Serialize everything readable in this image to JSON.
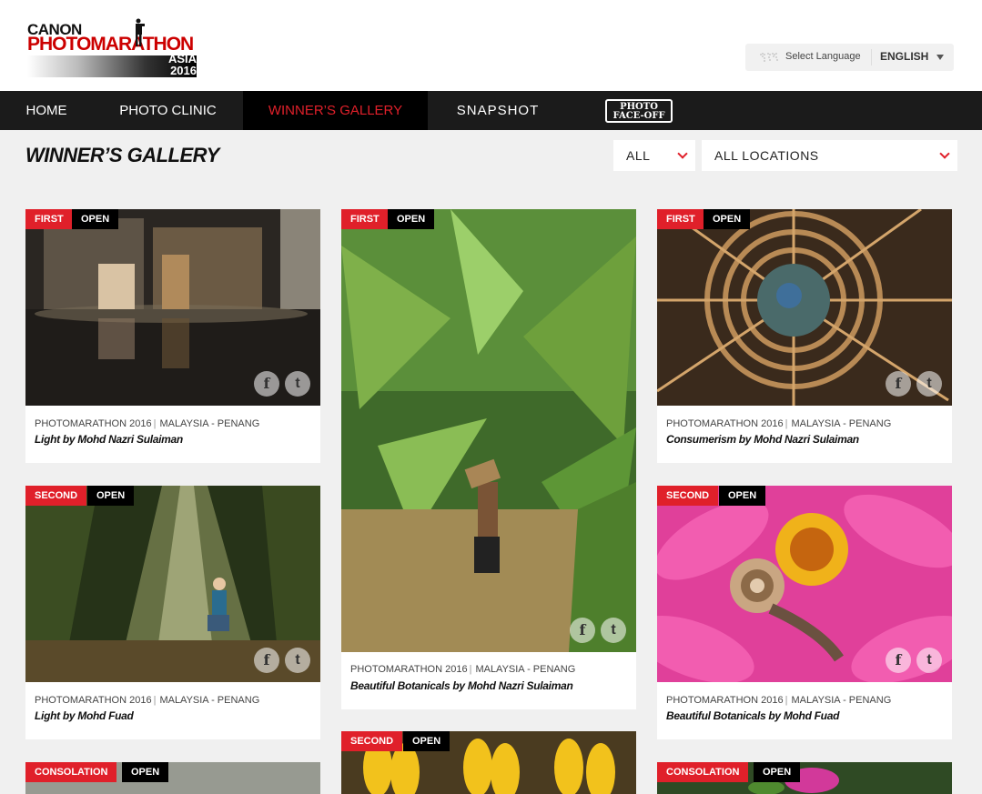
{
  "header": {
    "logo_line1": "CANON",
    "logo_line2": "PHOTOMARATHON",
    "logo_line3a": "ASIA",
    "logo_line3b": "2016",
    "select_language_label": "Select Language",
    "language": "ENGLISH"
  },
  "nav": {
    "home": "HOME",
    "photo_clinic": "PHOTO CLINIC",
    "winners_gallery": "WINNER’S GALLERY",
    "snapshot": "SNAPSHOT",
    "face_off_line1": "PHOTO",
    "face_off_line2": "FACE-OFF"
  },
  "page": {
    "title": "WINNER’S GALLERY",
    "filter_category": "ALL",
    "filter_location": "ALL LOCATIONS"
  },
  "accent_color": "#e0202a",
  "cards": [
    {
      "rank": "FIRST",
      "category": "OPEN",
      "event": "PHOTOMARATHON 2016",
      "location": "MALAYSIA - PENANG",
      "caption": "Light by Mohd Nazri Sulaiman"
    },
    {
      "rank": "FIRST",
      "category": "OPEN",
      "event": "PHOTOMARATHON 2016",
      "location": "MALAYSIA - PENANG",
      "caption": "Beautiful Botanicals by Mohd Nazri Sulaiman"
    },
    {
      "rank": "FIRST",
      "category": "OPEN",
      "event": "PHOTOMARATHON 2016",
      "location": "MALAYSIA - PENANG",
      "caption": "Consumerism by Mohd Nazri Sulaiman"
    },
    {
      "rank": "SECOND",
      "category": "OPEN",
      "event": "PHOTOMARATHON 2016",
      "location": "MALAYSIA - PENANG",
      "caption": "Light by Mohd Fuad"
    },
    {
      "rank": "SECOND",
      "category": "OPEN",
      "event": "PHOTOMARATHON 2016",
      "location": "MALAYSIA - PENANG",
      "caption": "Beautiful Botanicals by Mohd Fuad"
    },
    {
      "rank": "SECOND",
      "category": "OPEN"
    },
    {
      "rank": "CONSOLATION",
      "category": "OPEN"
    },
    {
      "rank": "CONSOLATION",
      "category": "OPEN"
    }
  ],
  "social_icons": [
    "facebook-icon",
    "twitter-icon"
  ]
}
